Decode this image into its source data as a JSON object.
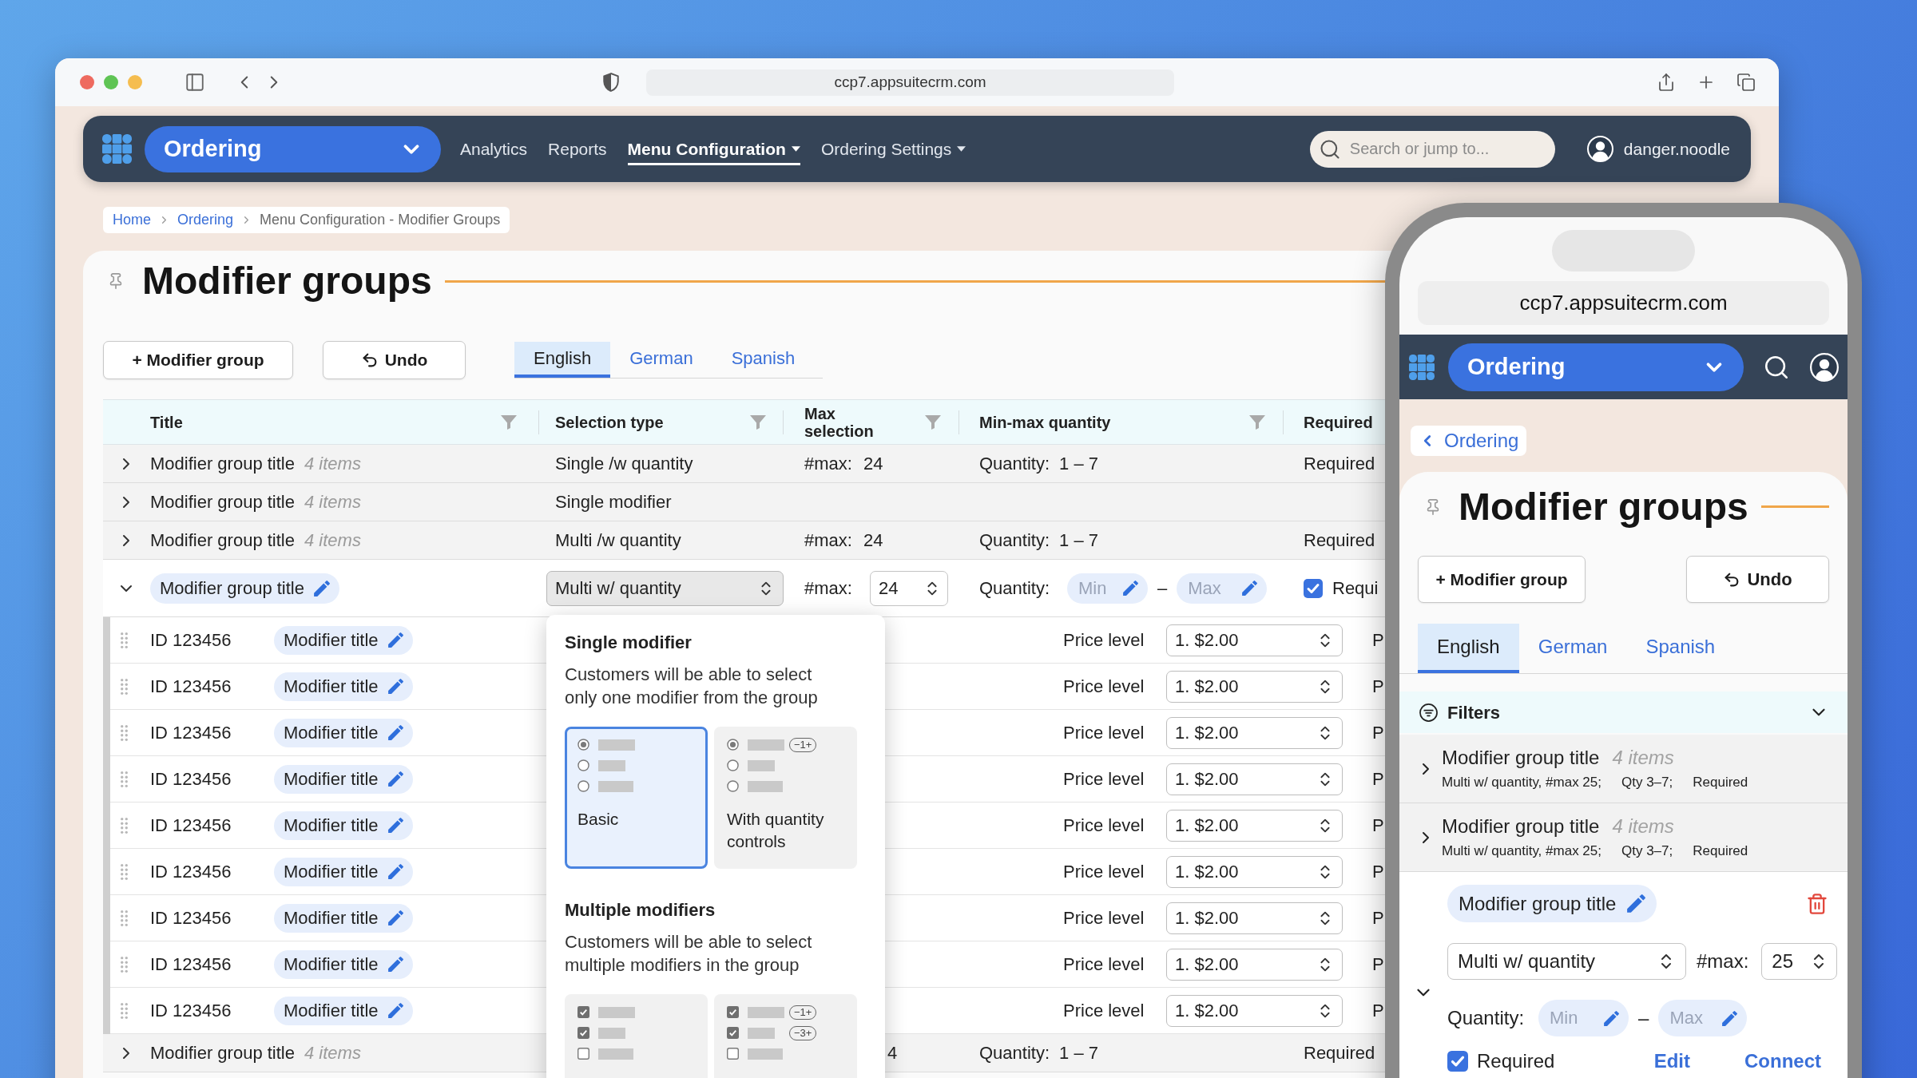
{
  "browser": {
    "url": "ccp7.appsuitecrm.com"
  },
  "nav": {
    "app": "Ordering",
    "links": [
      {
        "label": "Analytics",
        "selected": false,
        "dropdown": false
      },
      {
        "label": "Reports",
        "selected": false,
        "dropdown": false
      },
      {
        "label": "Menu Configuration",
        "selected": true,
        "dropdown": true
      },
      {
        "label": "Ordering Settings",
        "selected": false,
        "dropdown": true
      }
    ],
    "search": {
      "placeholder": "Search or jump to..."
    },
    "user": "danger.noodle"
  },
  "breadcrumb": [
    {
      "label": "Home",
      "link": true
    },
    {
      "label": "Ordering",
      "link": true
    },
    {
      "label": "Menu Configuration - Modifier Groups",
      "link": false
    }
  ],
  "page": {
    "title": "Modifier groups",
    "buttons": [
      {
        "label": "+ Modifier group",
        "kind": "add"
      },
      {
        "label": "Undo",
        "kind": "undo"
      }
    ],
    "tabs": [
      {
        "label": "English",
        "selected": true
      },
      {
        "label": "German",
        "selected": false
      },
      {
        "label": "Spanish",
        "selected": false
      }
    ]
  },
  "table": {
    "columns": [
      {
        "label": "Title",
        "filter": true
      },
      {
        "label": "Selection type",
        "filter": true
      },
      {
        "label": "Max selection",
        "filter": true
      },
      {
        "label": "Min-max quantity",
        "filter": true
      },
      {
        "label": "Required"
      }
    ],
    "rows": [
      {
        "expanded": false,
        "title": "Modifier group title",
        "items": "4 items",
        "selection": "Single /w quantity",
        "max_label": "#max:",
        "max": "24",
        "quantity_label": "Quantity:",
        "quantity": "1 – 7",
        "required": "Required"
      },
      {
        "expanded": false,
        "title": "Modifier group title",
        "items": "4 items",
        "selection": "Single modifier"
      },
      {
        "expanded": false,
        "title": "Modifier group title",
        "items": "4 items",
        "selection": "Multi /w quantity",
        "max_label": "#max:",
        "max": "24",
        "quantity_label": "Quantity:",
        "quantity": "1 – 7",
        "required": "Required"
      },
      {
        "expanded": true,
        "title": "Modifier group title",
        "selection": "Multi w/ quantity",
        "max_label": "#max:",
        "max": "24",
        "quantity_label": "Quantity:",
        "min_placeholder": "Min",
        "dash": "–",
        "max_placeholder": "Max",
        "required": {
          "label": "Requi",
          "checked": true
        },
        "modifiers": [
          {
            "id": "ID 123456",
            "title": "Modifier title",
            "price_label": "Price level",
            "price": "1. $2.00",
            "tail": "P"
          },
          {
            "id": "ID 123456",
            "title": "Modifier title",
            "price_label": "Price level",
            "price": "1. $2.00",
            "tail": "P"
          },
          {
            "id": "ID 123456",
            "title": "Modifier title",
            "price_label": "Price level",
            "price": "1. $2.00",
            "tail": "P"
          },
          {
            "id": "ID 123456",
            "title": "Modifier title",
            "price_label": "Price level",
            "price": "1. $2.00",
            "tail": "P"
          },
          {
            "id": "ID 123456",
            "title": "Modifier title",
            "price_label": "Price level",
            "price": "1. $2.00",
            "tail": "P"
          },
          {
            "id": "ID 123456",
            "title": "Modifier title",
            "price_label": "Price level",
            "price": "1. $2.00",
            "tail": "P"
          },
          {
            "id": "ID 123456",
            "title": "Modifier title",
            "price_label": "Price level",
            "price": "1. $2.00",
            "tail": "P"
          },
          {
            "id": "ID 123456",
            "title": "Modifier title",
            "price_label": "Price level",
            "price": "1. $2.00",
            "tail": "P"
          },
          {
            "id": "ID 123456",
            "title": "Modifier title",
            "price_label": "Price level",
            "price": "1. $2.00",
            "tail": "P"
          }
        ]
      },
      {
        "expanded": false,
        "title": "Modifier group title",
        "items": "4 items",
        "max_tail": "4",
        "quantity_label": "Quantity:",
        "quantity": "1 – 7",
        "required": "Required"
      }
    ]
  },
  "popover": {
    "sections": [
      {
        "title": "Single modifier",
        "text": "Customers will be able to select only one modifier from the group",
        "options": [
          {
            "label": "Basic",
            "kind": "radio",
            "selected": true,
            "rows": [
              {
                "checked": true
              },
              {
                "checked": false
              },
              {
                "checked": false
              }
            ]
          },
          {
            "label": "With quantity controls",
            "kind": "radio",
            "selected": false,
            "rows": [
              {
                "checked": true,
                "stepper": "−1+"
              },
              {
                "checked": false
              },
              {
                "checked": false
              }
            ]
          }
        ]
      },
      {
        "title": "Multiple modifiers",
        "text": "Customers will be able to select multiple modifiers in the group",
        "options": [
          {
            "kind": "checkbox",
            "selected": false,
            "rows": [
              {
                "checked": true
              },
              {
                "checked": true
              },
              {
                "checked": false
              }
            ]
          },
          {
            "kind": "checkbox",
            "selected": false,
            "rows": [
              {
                "checked": true,
                "stepper": "−1+"
              },
              {
                "checked": true,
                "stepper": "−3+"
              },
              {
                "checked": false
              }
            ]
          }
        ]
      }
    ]
  },
  "phone": {
    "url": "ccp7.appsuitecrm.com",
    "app": "Ordering",
    "back": "Ordering",
    "title": "Modifier groups",
    "buttons": [
      {
        "label": "+ Modifier group",
        "kind": "add"
      },
      {
        "label": "Undo",
        "kind": "undo"
      }
    ],
    "tabs": [
      {
        "label": "English",
        "selected": true
      },
      {
        "label": "German",
        "selected": false
      },
      {
        "label": "Spanish",
        "selected": false
      }
    ],
    "filters": {
      "label": "Filters",
      "expanded": false
    },
    "groups": [
      {
        "expanded": false,
        "title": "Modifier group title",
        "items": "4 items",
        "summary": [
          "Multi w/ quantity, #max 25;",
          "Qty 3–7;",
          "Required"
        ]
      },
      {
        "expanded": false,
        "title": "Modifier group title",
        "items": "4 items",
        "summary": [
          "Multi w/ quantity, #max 25;",
          "Qty 3–7;",
          "Required"
        ]
      },
      {
        "expanded": true,
        "title": "Modifier group title",
        "selection": "Multi w/ quantity",
        "max_label": "#max:",
        "max": "25",
        "quantity_label": "Quantity:",
        "min_placeholder": "Min",
        "dash": "–",
        "max_placeholder": "Max",
        "required": {
          "label": "Required",
          "checked": true
        },
        "actions": [
          "Edit",
          "Connect"
        ]
      }
    ]
  }
}
